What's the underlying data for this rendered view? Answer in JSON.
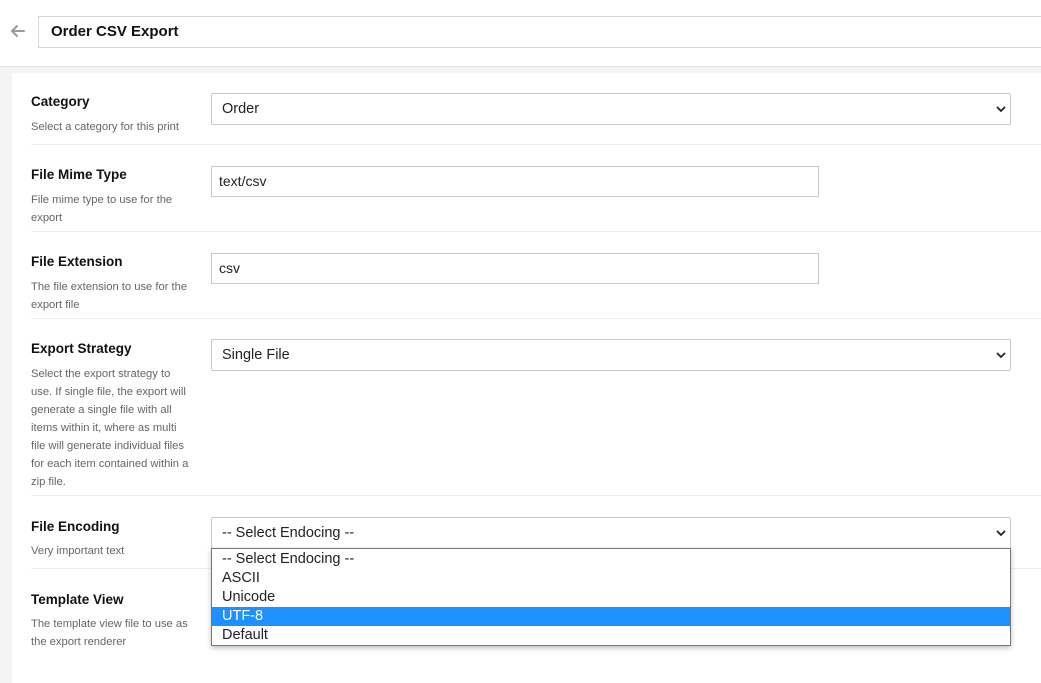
{
  "header": {
    "title": "Order CSV Export",
    "back_icon": "arrow-left-icon"
  },
  "fields": {
    "category": {
      "label": "Category",
      "help": "Select a category for this print",
      "value": "Order"
    },
    "mime": {
      "label": "File Mime Type",
      "help": "File mime type to use for the export",
      "value": "text/csv"
    },
    "extension": {
      "label": "File Extension",
      "help": "The file extension to use for the export file",
      "value": "csv"
    },
    "strategy": {
      "label": "Export Strategy",
      "help": "Select the export strategy to use. If single file, the export will generate a single file with all items within it, where as multi file will generate individual files for each item contained within a zip file.",
      "value": "Single File"
    },
    "encoding": {
      "label": "File Encoding",
      "help": "Very important text",
      "value": "-- Select Endocing --",
      "options": [
        "-- Select Endocing --",
        "ASCII",
        "Unicode",
        "UTF-8",
        "Default"
      ],
      "highlighted": "UTF-8"
    },
    "template": {
      "label": "Template View",
      "help": "The template view file to use as the export renderer"
    }
  },
  "colors": {
    "highlight": "#1e90ff",
    "label": "#111111",
    "help_text": "#666666",
    "border": "#c9c9c9"
  }
}
